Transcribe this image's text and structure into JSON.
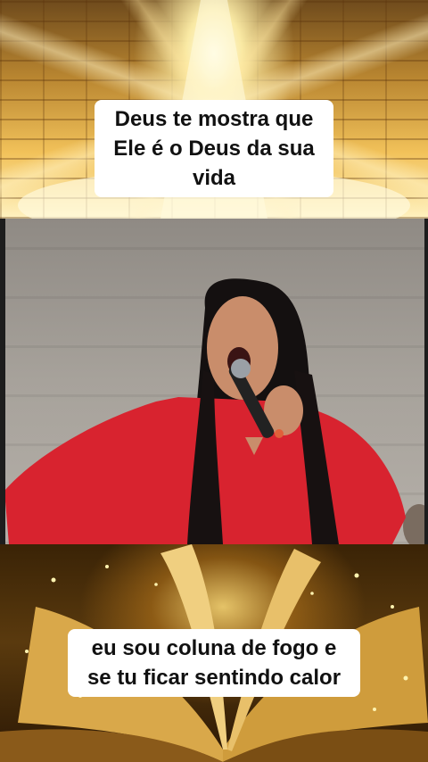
{
  "top_panel": {
    "caption": "Deus te mostra que Ele é o Deus da sua vida"
  },
  "bottom_panel": {
    "caption": "eu sou coluna de fogo e se tu ficar sentindo calor"
  },
  "colors": {
    "caption_bg": "#ffffff",
    "caption_text": "#111111",
    "speaker_dress": "#d8232f",
    "gold_light": "#f2c25a"
  }
}
